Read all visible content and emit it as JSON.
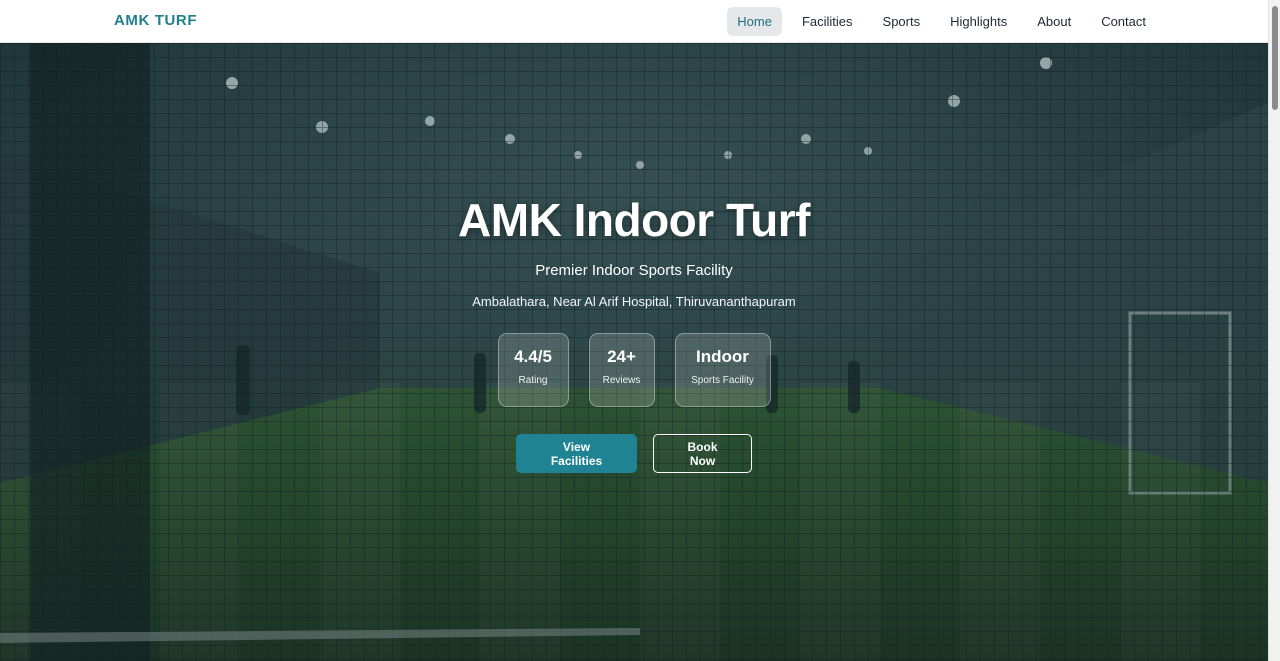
{
  "brand": "AMK TURF",
  "nav": {
    "items": [
      {
        "label": "Home",
        "active": true
      },
      {
        "label": "Facilities",
        "active": false
      },
      {
        "label": "Sports",
        "active": false
      },
      {
        "label": "Highlights",
        "active": false
      },
      {
        "label": "About",
        "active": false
      },
      {
        "label": "Contact",
        "active": false
      }
    ]
  },
  "hero": {
    "title": "AMK Indoor Turf",
    "subtitle": "Premier Indoor Sports Facility",
    "location": "Ambalathara, Near Al Arif Hospital, Thiruvananthapuram",
    "stats": [
      {
        "value": "4.4/5",
        "label": "Rating"
      },
      {
        "value": "24+",
        "label": "Reviews"
      },
      {
        "value": "Indoor",
        "label": "Sports Facility"
      }
    ],
    "primary_button": "View Facilities",
    "secondary_button": "Book Now",
    "background_image": "indoor-turf-photo"
  },
  "colors": {
    "accent": "#1f8394",
    "brand": "#1f7f8c",
    "nav_active_bg": "#e5e7eb"
  }
}
